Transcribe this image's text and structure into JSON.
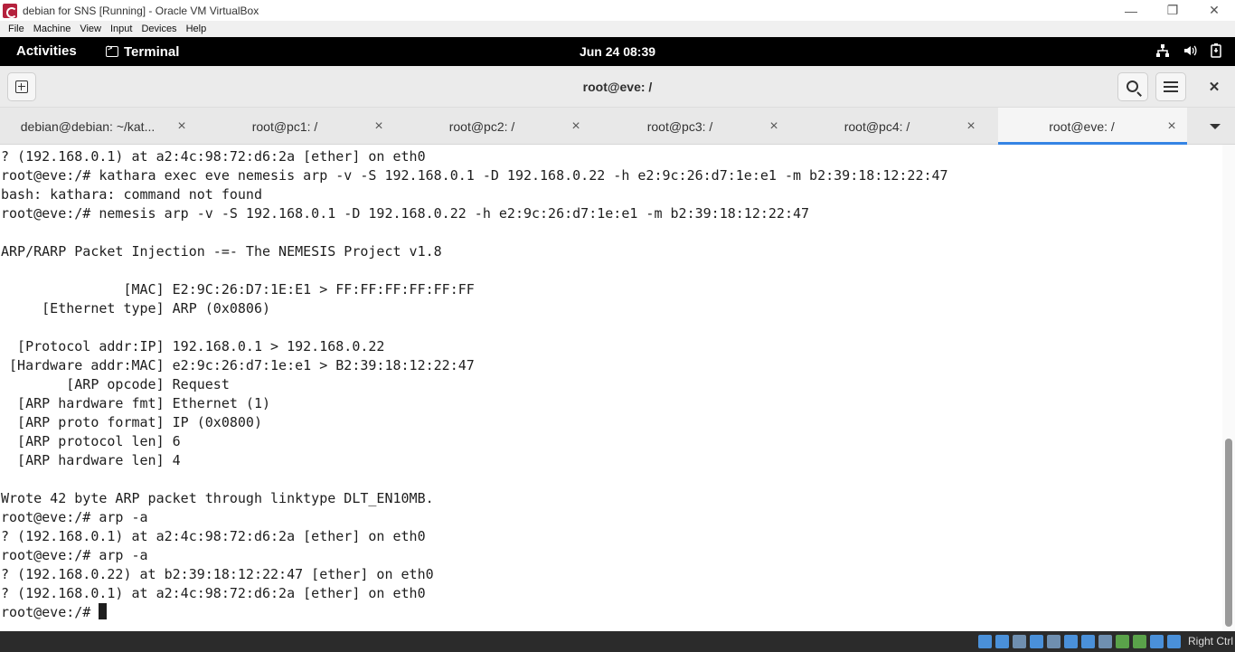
{
  "host_window": {
    "title": "debian for SNS [Running] - Oracle VM VirtualBox",
    "minimize": "—",
    "restore": "❐",
    "close": "✕"
  },
  "vbox_menu": [
    "File",
    "Machine",
    "View",
    "Input",
    "Devices",
    "Help"
  ],
  "gnome": {
    "activities": "Activities",
    "app_name": "Terminal",
    "clock": "Jun 24  08:39",
    "tray_icons": [
      "network-icon",
      "volume-icon",
      "battery-icon"
    ]
  },
  "terminal_header": {
    "title": "root@eve: /"
  },
  "tabs": [
    {
      "label": "debian@debian: ~/kat...",
      "active": false
    },
    {
      "label": "root@pc1: /",
      "active": false
    },
    {
      "label": "root@pc2: /",
      "active": false
    },
    {
      "label": "root@pc3: /",
      "active": false
    },
    {
      "label": "root@pc4: /",
      "active": false
    },
    {
      "label": "root@eve: /",
      "active": true
    }
  ],
  "terminal_lines": [
    "? (192.168.0.1) at a2:4c:98:72:d6:2a [ether] on eth0",
    "root@eve:/# kathara exec eve nemesis arp -v -S 192.168.0.1 -D 192.168.0.22 -h e2:9c:26:d7:1e:e1 -m b2:39:18:12:22:47",
    "bash: kathara: command not found",
    "root@eve:/# nemesis arp -v -S 192.168.0.1 -D 192.168.0.22 -h e2:9c:26:d7:1e:e1 -m b2:39:18:12:22:47",
    "",
    "ARP/RARP Packet Injection -=- The NEMESIS Project v1.8",
    "",
    "               [MAC] E2:9C:26:D7:1E:E1 > FF:FF:FF:FF:FF:FF",
    "     [Ethernet type] ARP (0x0806)",
    "",
    "  [Protocol addr:IP] 192.168.0.1 > 192.168.0.22",
    " [Hardware addr:MAC] e2:9c:26:d7:1e:e1 > B2:39:18:12:22:47",
    "        [ARP opcode] Request",
    "  [ARP hardware fmt] Ethernet (1)",
    "  [ARP proto format] IP (0x0800)",
    "  [ARP protocol len] 6",
    "  [ARP hardware len] 4",
    "",
    "Wrote 42 byte ARP packet through linktype DLT_EN10MB.",
    "root@eve:/# arp -a",
    "? (192.168.0.1) at a2:4c:98:72:d6:2a [ether] on eth0",
    "root@eve:/# arp -a",
    "? (192.168.0.22) at b2:39:18:12:22:47 [ether] on eth0",
    "? (192.168.0.1) at a2:4c:98:72:d6:2a [ether] on eth0"
  ],
  "prompt": "root@eve:/# ",
  "status_bar": {
    "host_key": "Right Ctrl"
  },
  "colors": {
    "accent": "#3584e4",
    "gnome_bar": "#000000",
    "terminal_fg": "#1e1e1e",
    "status_bar": "#2b2b2b"
  }
}
